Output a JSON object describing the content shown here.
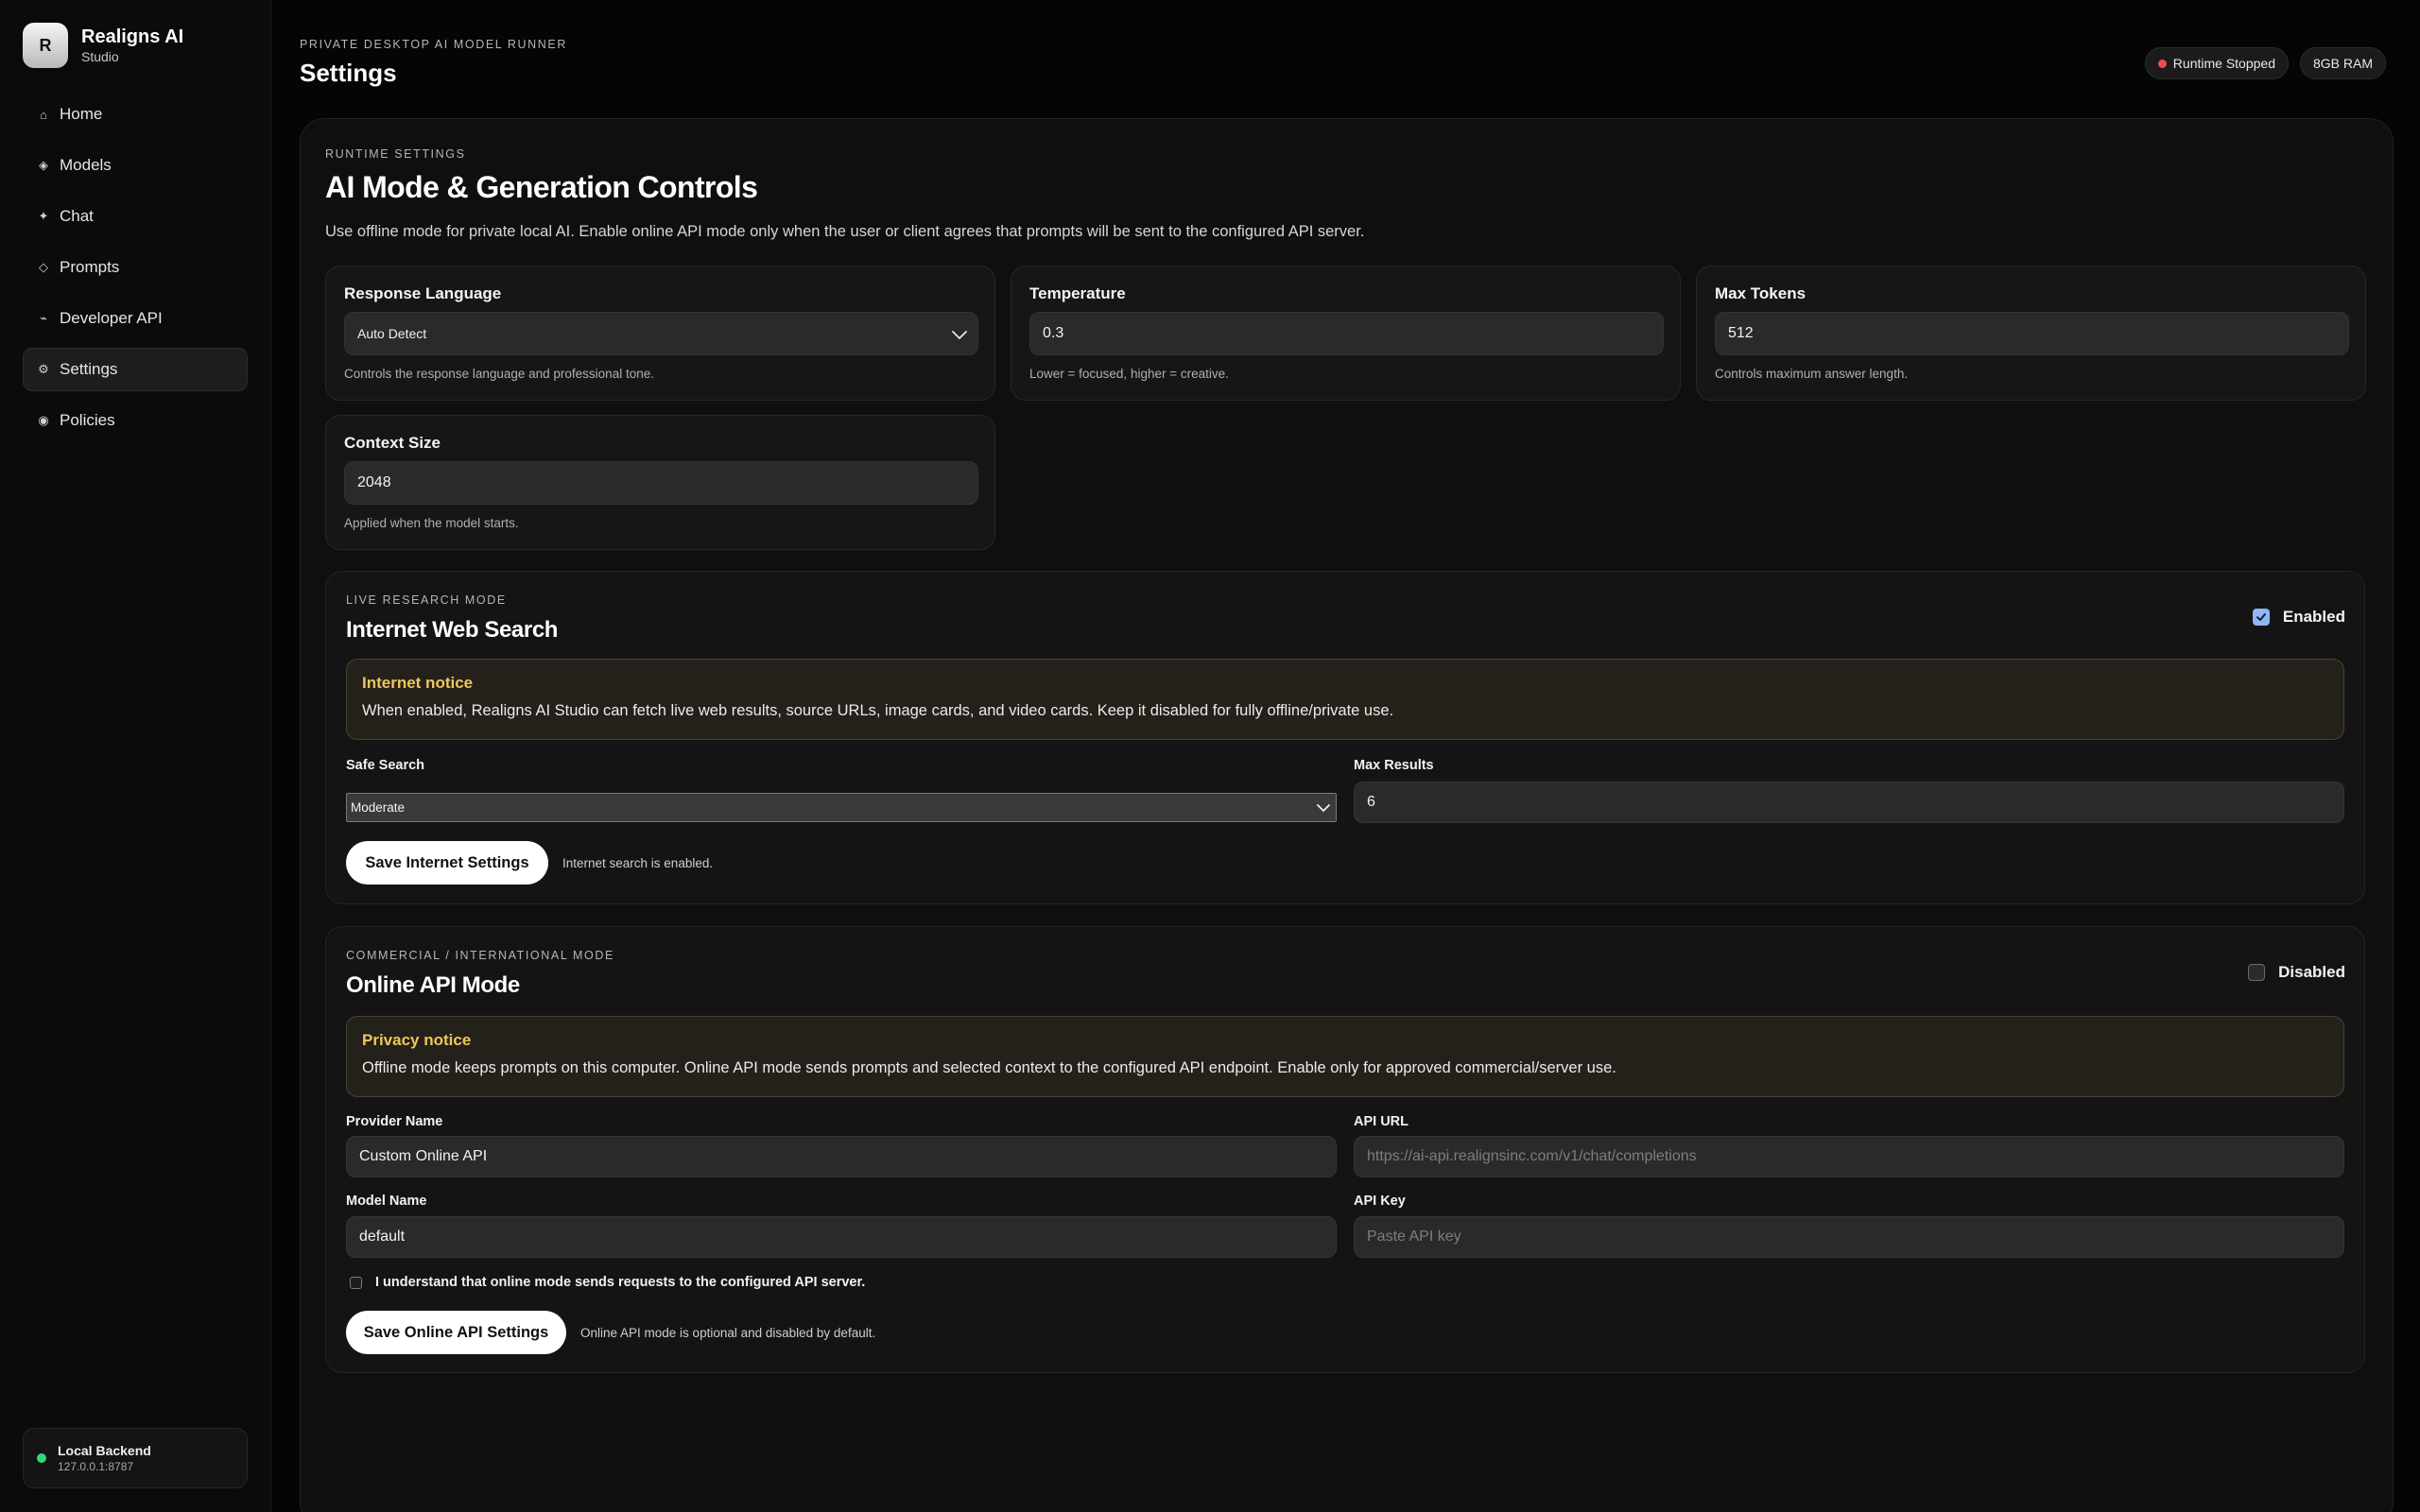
{
  "brand": {
    "logo_letter": "R",
    "name": "Realigns AI",
    "subtitle": "Studio"
  },
  "sidebar": {
    "items": [
      {
        "label": "Home",
        "icon": "home-icon",
        "glyph": "⌂"
      },
      {
        "label": "Models",
        "icon": "diamond-icon",
        "glyph": "◈"
      },
      {
        "label": "Chat",
        "icon": "sparkle-icon",
        "glyph": "✦"
      },
      {
        "label": "Prompts",
        "icon": "diamond-outline-icon",
        "glyph": "◇"
      },
      {
        "label": "Developer API",
        "icon": "dash-icon",
        "glyph": "⌁"
      },
      {
        "label": "Settings",
        "icon": "gear-icon",
        "glyph": "⚙",
        "active": true
      },
      {
        "label": "Policies",
        "icon": "shield-icon",
        "glyph": "◉"
      }
    ],
    "backend": {
      "title": "Local Backend",
      "address": "127.0.0.1:8787",
      "status_color": "#37d67a"
    }
  },
  "header": {
    "eyebrow": "PRIVATE DESKTOP AI MODEL RUNNER",
    "title": "Settings",
    "runtime_status": "Runtime Stopped",
    "runtime_status_color": "#ef4d4d",
    "ram": "8GB RAM"
  },
  "runtime": {
    "eyebrow": "RUNTIME SETTINGS",
    "title": "AI Mode & Generation Controls",
    "description": "Use offline mode for private local AI. Enable online API mode only when the user or client agrees that prompts will be sent to the configured API server.",
    "response_language": {
      "label": "Response Language",
      "value": "Auto Detect",
      "hint": "Controls the response language and professional tone."
    },
    "temperature": {
      "label": "Temperature",
      "value": "0.3",
      "hint": "Lower = focused, higher = creative."
    },
    "max_tokens": {
      "label": "Max Tokens",
      "value": "512",
      "hint": "Controls maximum answer length."
    },
    "context_size": {
      "label": "Context Size",
      "value": "2048",
      "hint": "Applied when the model starts."
    }
  },
  "web_search": {
    "eyebrow": "LIVE RESEARCH MODE",
    "title": "Internet Web Search",
    "toggle_label": "Enabled",
    "enabled": true,
    "notice_title": "Internet notice",
    "notice_text": "When enabled, Realigns AI Studio can fetch live web results, source URLs, image cards, and video cards. Keep it disabled for fully offline/private use.",
    "safe_search_label": "Safe Search",
    "safe_search_value": "Moderate",
    "max_results_label": "Max Results",
    "max_results_value": "6",
    "save_label": "Save Internet Settings",
    "status": "Internet search is enabled."
  },
  "online_api": {
    "eyebrow": "COMMERCIAL / INTERNATIONAL MODE",
    "title": "Online API Mode",
    "toggle_label": "Disabled",
    "enabled": false,
    "notice_title": "Privacy notice",
    "notice_text": "Offline mode keeps prompts on this computer. Online API mode sends prompts and selected context to the configured API endpoint. Enable only for approved commercial/server use.",
    "provider_label": "Provider Name",
    "provider_value": "Custom Online API",
    "api_url_label": "API URL",
    "api_url_placeholder": "https://ai-api.realignsinc.com/v1/chat/completions",
    "model_label": "Model Name",
    "model_value": "default",
    "api_key_label": "API Key",
    "api_key_placeholder": "Paste API key",
    "agree_text": "I understand that online mode sends requests to the configured API server.",
    "save_label": "Save Online API Settings",
    "status": "Online API mode is optional and disabled by default."
  },
  "colors": {
    "accent_notice": "#f0c65b",
    "checkbox_on": "#8fb6f5",
    "background": "#050505"
  }
}
